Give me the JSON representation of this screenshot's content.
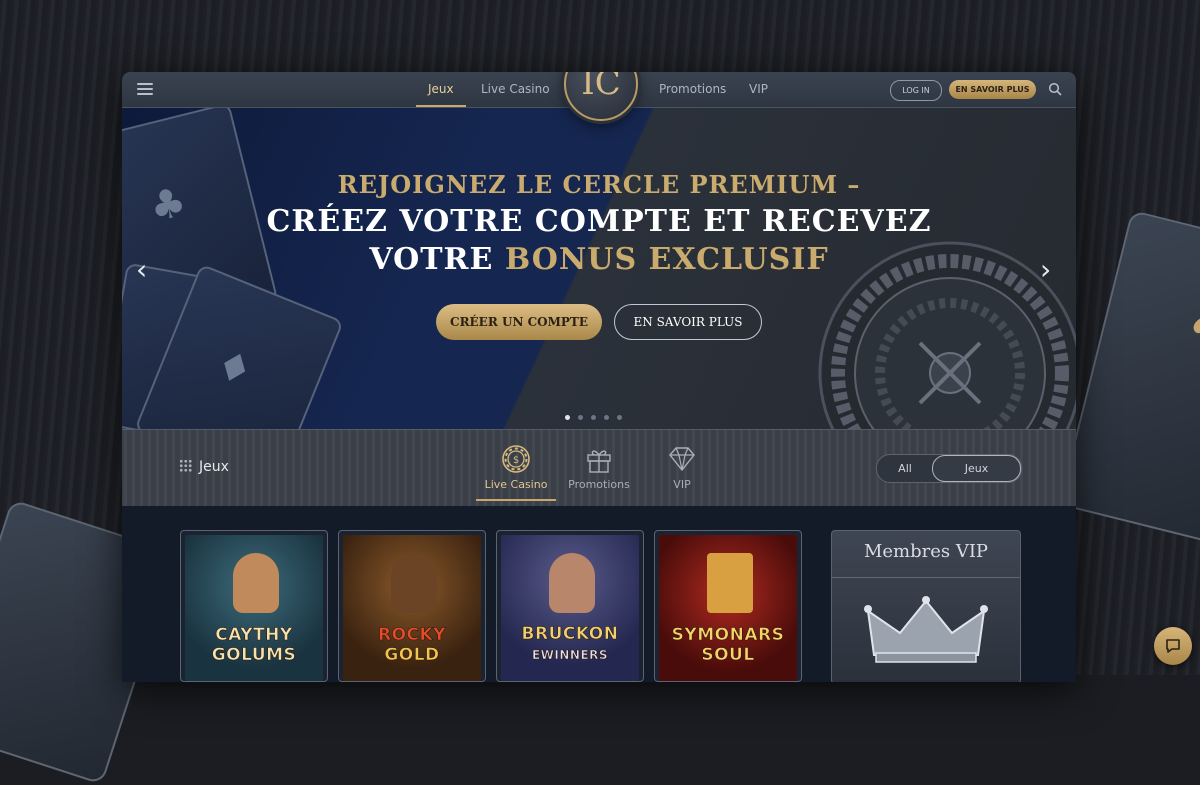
{
  "nav": {
    "links": [
      "Jeux",
      "Live Casino",
      "Promotions",
      "VIP"
    ],
    "login_label": "LOG IN",
    "cta_label": "EN SAVOIR PLUS",
    "logo_text": "ꟾC"
  },
  "hero": {
    "line1": "REJOIGNEZ LE CERCLE PREMIUM –",
    "line2": "CRÉEZ VOTRE COMPTE ET RECEVEZ",
    "line3_white": "VOTRE",
    "line3_gold": "BONUS EXCLUSIF",
    "primary_button": "CRÉER UN COMPTE",
    "secondary_button": "EN SAVOIR PLUS",
    "slides_total": 5,
    "active_slide": 1
  },
  "categories": {
    "section_label": "Jeux",
    "items": [
      "Live Casino",
      "Promotions",
      "VIP"
    ],
    "active": "Live Casino",
    "toggle": [
      "All",
      "Jeux"
    ]
  },
  "games": [
    {
      "line1": "CAYTHY",
      "line2": "GOLUMS"
    },
    {
      "line1": "ROCKY",
      "line2": "GOLD"
    },
    {
      "line1": "BRUCKON",
      "line2": "EWINNERS"
    },
    {
      "line1": "SYMONARS",
      "line2": "SOUL"
    }
  ],
  "vip_panel": {
    "title": "Membres VIP"
  },
  "colors": {
    "gold": "#c9ab6e",
    "navy": "#152650",
    "slate": "#2e3642"
  }
}
